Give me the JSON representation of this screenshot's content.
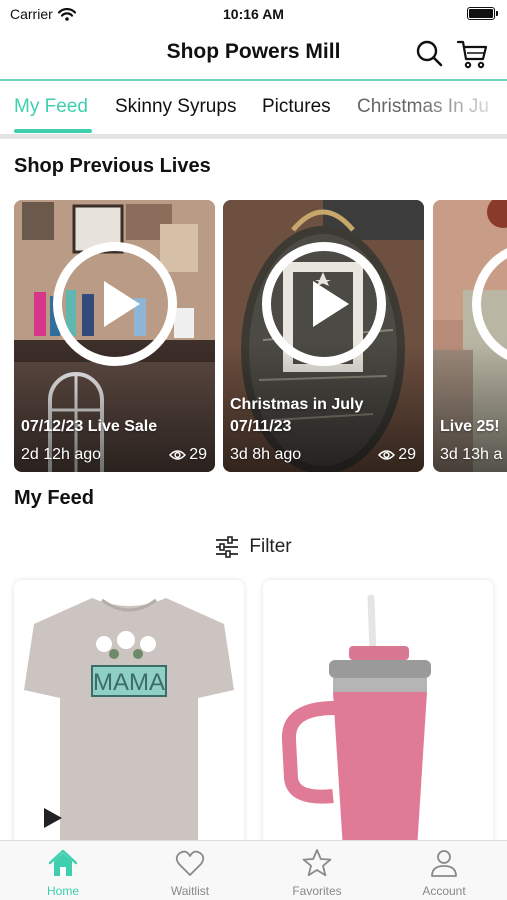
{
  "status_bar": {
    "carrier": "Carrier",
    "time": "10:16 AM"
  },
  "header": {
    "title": "Shop Powers Mill"
  },
  "tabs": [
    {
      "label": "My Feed"
    },
    {
      "label": "Skinny Syrups"
    },
    {
      "label": "Pictures"
    },
    {
      "label": "Christmas In Ju"
    }
  ],
  "lives_section": {
    "title": "Shop Previous Lives",
    "items": [
      {
        "title_line1": "",
        "title_line2": "07/12/23 Live Sale",
        "time_ago": "2d 12h ago",
        "views": "29"
      },
      {
        "title_line1": "Christmas in July",
        "title_line2": "07/11/23",
        "time_ago": "3d 8h ago",
        "views": "29"
      },
      {
        "title_line1": "",
        "title_line2": "Live 25!",
        "time_ago": "3d 13h a",
        "views": ""
      }
    ]
  },
  "feed_section": {
    "title": "My Feed",
    "filter_label": "Filter"
  },
  "products": [
    {
      "shirt_text": "MAMA",
      "icon": "t-shirt",
      "color": "#cbc4c0"
    },
    {
      "icon": "tumbler",
      "color": "#e07b97"
    }
  ],
  "tab_bar": [
    {
      "label": "Home",
      "icon": "home-icon",
      "active": true
    },
    {
      "label": "Waitlist",
      "icon": "heart-icon",
      "active": false
    },
    {
      "label": "Favorites",
      "icon": "star-icon",
      "active": false
    },
    {
      "label": "Account",
      "icon": "person-icon",
      "active": false
    }
  ],
  "colors": {
    "accent": "#3fcfae",
    "header_line": "#6fd3bb"
  }
}
